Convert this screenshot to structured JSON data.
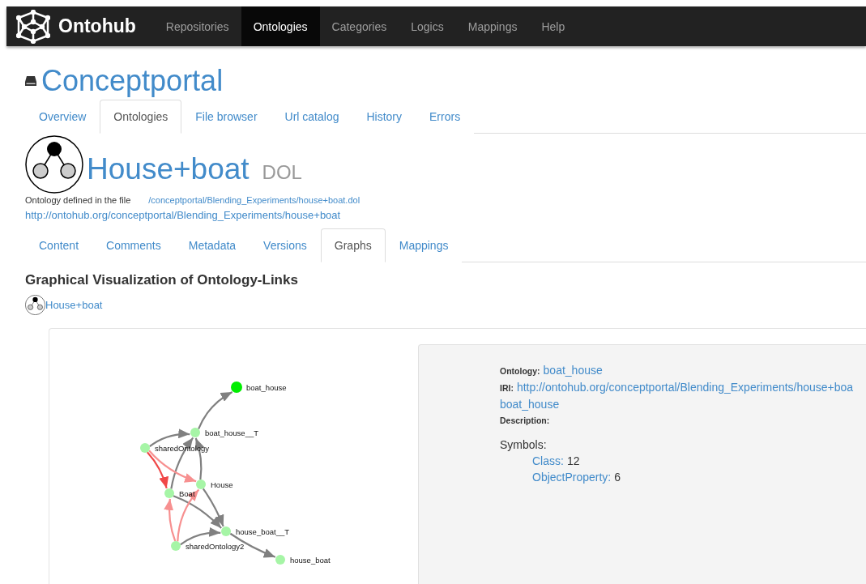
{
  "navbar": {
    "brand": "Ontohub",
    "items": [
      {
        "label": "Repositories",
        "selected": false
      },
      {
        "label": "Ontologies",
        "selected": true
      },
      {
        "label": "Categories",
        "selected": false
      },
      {
        "label": "Logics",
        "selected": false
      },
      {
        "label": "Mappings",
        "selected": false
      },
      {
        "label": "Help",
        "selected": false
      }
    ]
  },
  "repository": {
    "title": "Conceptportal",
    "tabs": [
      {
        "label": "Overview",
        "selected": false
      },
      {
        "label": "Ontologies",
        "selected": true
      },
      {
        "label": "File browser",
        "selected": false
      },
      {
        "label": "Url catalog",
        "selected": false
      },
      {
        "label": "History",
        "selected": false
      },
      {
        "label": "Errors",
        "selected": false
      }
    ]
  },
  "ontology": {
    "title": "House+boat",
    "language": "DOL",
    "defined_label": "Ontology defined in the file",
    "file_link": "/conceptportal/Blending_Experiments/house+boat.dol",
    "iri": "http://ontohub.org/conceptportal/Blending_Experiments/house+boat",
    "tabs": [
      {
        "label": "Content",
        "selected": false
      },
      {
        "label": "Comments",
        "selected": false
      },
      {
        "label": "Metadata",
        "selected": false
      },
      {
        "label": "Versions",
        "selected": false
      },
      {
        "label": "Graphs",
        "selected": true
      },
      {
        "label": "Mappings",
        "selected": false
      }
    ]
  },
  "section": {
    "heading": "Graphical Visualization of Ontology-Links",
    "link": "House+boat"
  },
  "graph": {
    "nodes": [
      {
        "label": "boat_house",
        "color": "#00ee00"
      },
      {
        "label": "boat_house__T",
        "color": "#a6f5a6"
      },
      {
        "label": "sharedOntology",
        "color": "#a6f5a6"
      },
      {
        "label": "House",
        "color": "#a6f5a6"
      },
      {
        "label": "Boat",
        "color": "#a6f5a6"
      },
      {
        "label": "house_boat__T",
        "color": "#a6f5a6"
      },
      {
        "label": "sharedOntology2",
        "color": "#a6f5a6"
      },
      {
        "label": "house_boat",
        "color": "#a6f5a6"
      }
    ],
    "edges": [
      {
        "color": "#808080"
      },
      {
        "color": "#808080"
      },
      {
        "color": "#808080"
      },
      {
        "color": "#808080"
      },
      {
        "color": "#f04848"
      },
      {
        "color": "#f79090"
      },
      {
        "color": "#808080"
      },
      {
        "color": "#808080"
      },
      {
        "color": "#f79090"
      },
      {
        "color": "#f79090"
      },
      {
        "color": "#808080"
      },
      {
        "color": "#808080"
      }
    ]
  },
  "details": {
    "ontology_label": "Ontology:",
    "ontology_value": "boat_house",
    "iri_label": "IRI:",
    "iri_value": "http://ontohub.org/conceptportal/Blending_Experiments/house+boa",
    "iri_continuation": "boat_house",
    "description_label": "Description:",
    "symbols_label": "Symbols:",
    "symbols": [
      {
        "name": "Class:",
        "count": "12"
      },
      {
        "name": "ObjectProperty:",
        "count": "6"
      }
    ]
  }
}
